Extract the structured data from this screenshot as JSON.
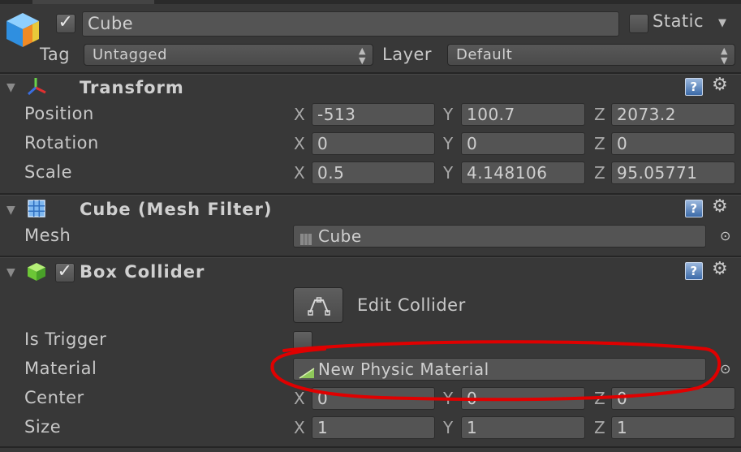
{
  "object": {
    "name": "Cube",
    "active": true,
    "static_label": "Static",
    "static_checked": false,
    "tag_label": "Tag",
    "tag_value": "Untagged",
    "layer_label": "Layer",
    "layer_value": "Default"
  },
  "transform": {
    "title": "Transform",
    "rows": [
      {
        "label": "Position",
        "x": "-513",
        "y": "100.7",
        "z": "2073.2"
      },
      {
        "label": "Rotation",
        "x": "0",
        "y": "0",
        "z": "0"
      },
      {
        "label": "Scale",
        "x": "0.5",
        "y": "4.148106",
        "z": "95.05771"
      }
    ]
  },
  "mesh_filter": {
    "title": "Cube (Mesh Filter)",
    "mesh_label": "Mesh",
    "mesh_value": "Cube"
  },
  "box_collider": {
    "title": "Box Collider",
    "enabled": true,
    "edit_label": "Edit Collider",
    "is_trigger_label": "Is Trigger",
    "is_trigger": false,
    "material_label": "Material",
    "material_value": "New Physic Material",
    "center": {
      "label": "Center",
      "x": "0",
      "y": "0",
      "z": "0"
    },
    "size": {
      "label": "Size",
      "x": "1",
      "y": "1",
      "z": "1"
    }
  },
  "axes": {
    "x": "X",
    "y": "Y",
    "z": "Z"
  },
  "glyphs": {
    "check": "✓",
    "help": "?",
    "gear": "⚙",
    "target": "⊙",
    "fold": "▼",
    "updown": "▲▼"
  },
  "colors": {
    "background": "#383838",
    "field": "#545454",
    "annotation": "#e00000",
    "help_blue": "#3c6aa8"
  },
  "icons": [
    "cube-icon",
    "transform-axis-icon",
    "mesh-grid-icon",
    "collider-cube-icon",
    "help-icon",
    "gear-icon",
    "object-picker-icon",
    "edit-collider-icon",
    "physic-material-icon"
  ]
}
